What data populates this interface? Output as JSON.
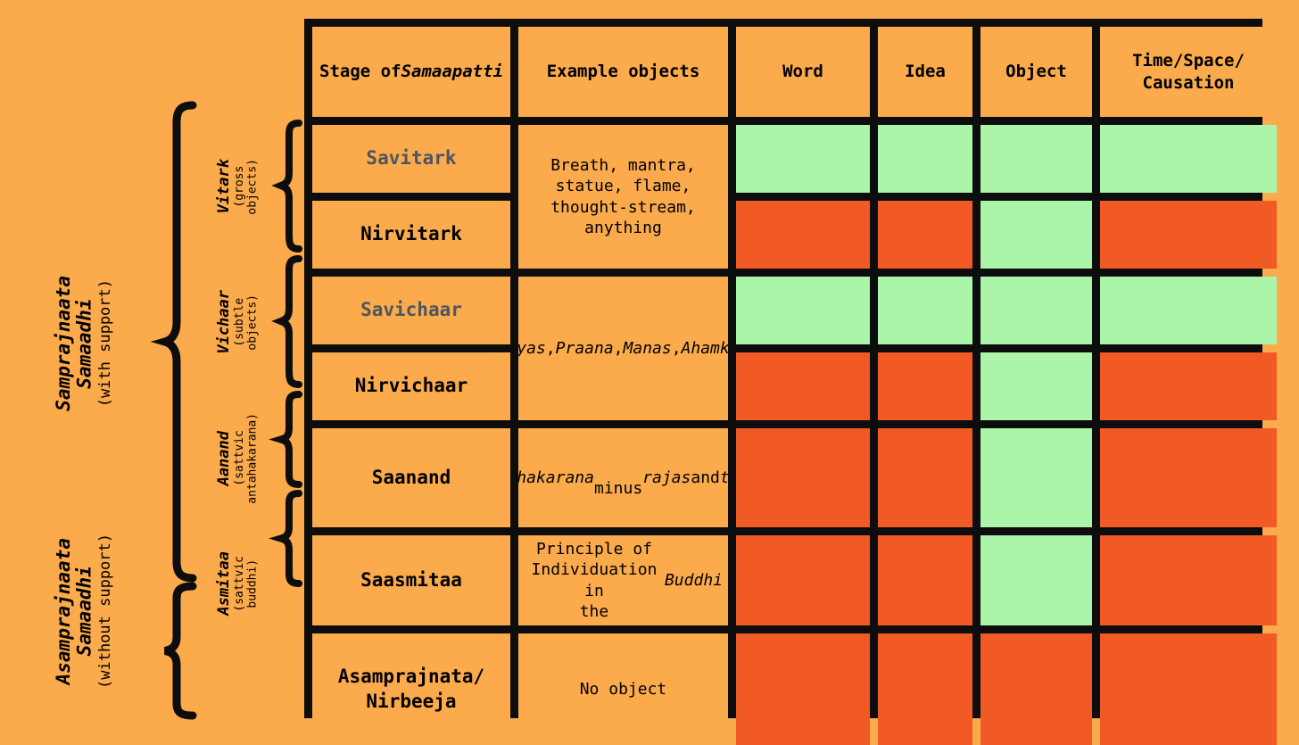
{
  "colors": {
    "background": "#fbaa4c",
    "cell_fill": "#fbaa4c",
    "border": "#0d0d0d",
    "present_green": "#aaf5aa",
    "absent_red": "#f15a24",
    "muted_text": "#4d5563",
    "text": "#000000"
  },
  "outer_groups": [
    {
      "name": "Samprajnaata\nSamaadhi",
      "note": "(with support)"
    },
    {
      "name": "Asamprajnaata\nSamaadhi",
      "note": "(without support)"
    }
  ],
  "mid_groups": [
    {
      "name": "Vitark",
      "note": "(gross\nobjects)"
    },
    {
      "name": "Vichaar",
      "note": "(subtle\nobjects)"
    },
    {
      "name": "Aanand",
      "note": "(sattvic\nantahakarana)"
    },
    {
      "name": "Asmitaa",
      "note": "(sattvic\nbuddhi)"
    }
  ],
  "table": {
    "headers": [
      {
        "plain": "Stage of",
        "italic": "Samaapatti"
      },
      {
        "plain": "Example objects",
        "italic": ""
      },
      {
        "plain": "Word",
        "italic": ""
      },
      {
        "plain": "Idea",
        "italic": ""
      },
      {
        "plain": "Object",
        "italic": ""
      },
      {
        "plain": "Time/Space/\nCausation",
        "italic": ""
      }
    ],
    "rows": [
      {
        "stage": "Savitark",
        "stage_muted": true,
        "example": "Breath, mantra,\nstatue, flame,\nthought-stream,\nanything",
        "example_rowspan": 2,
        "word": "green",
        "idea": "green",
        "object": "green",
        "tsc": "green"
      },
      {
        "stage": "Nirvitark",
        "stage_muted": false,
        "example": null,
        "word": "red",
        "idea": "red",
        "object": "green",
        "tsc": "red"
      },
      {
        "stage": "Savichaar",
        "stage_muted": true,
        "example": "Tanmaatras,\nIndriyas,\nPraana,Manas,\nAhamkaar, Buddhi\n(in this order)",
        "example_rowspan": 2,
        "word": "green",
        "idea": "green",
        "object": "green",
        "tsc": "green"
      },
      {
        "stage": "Nirvichaar",
        "stage_muted": false,
        "example": null,
        "word": "red",
        "idea": "red",
        "object": "green",
        "tsc": "red"
      },
      {
        "stage": "Saanand",
        "stage_muted": false,
        "example": "Antahakarana\nminus rajas and\ntamas",
        "example_rowspan": 1,
        "word": "red",
        "idea": "red",
        "object": "green",
        "tsc": "red"
      },
      {
        "stage": "Saasmitaa",
        "stage_muted": false,
        "example": "Principle of\nIndividuation in\nthe Buddhi",
        "example_rowspan": 1,
        "word": "red",
        "idea": "red",
        "object": "green",
        "tsc": "red"
      },
      {
        "stage": "Asamprajnata/\nNirbeeja",
        "stage_muted": false,
        "example": "No object",
        "example_rowspan": 1,
        "word": "red",
        "idea": "red",
        "object": "red",
        "tsc": "red"
      }
    ]
  }
}
